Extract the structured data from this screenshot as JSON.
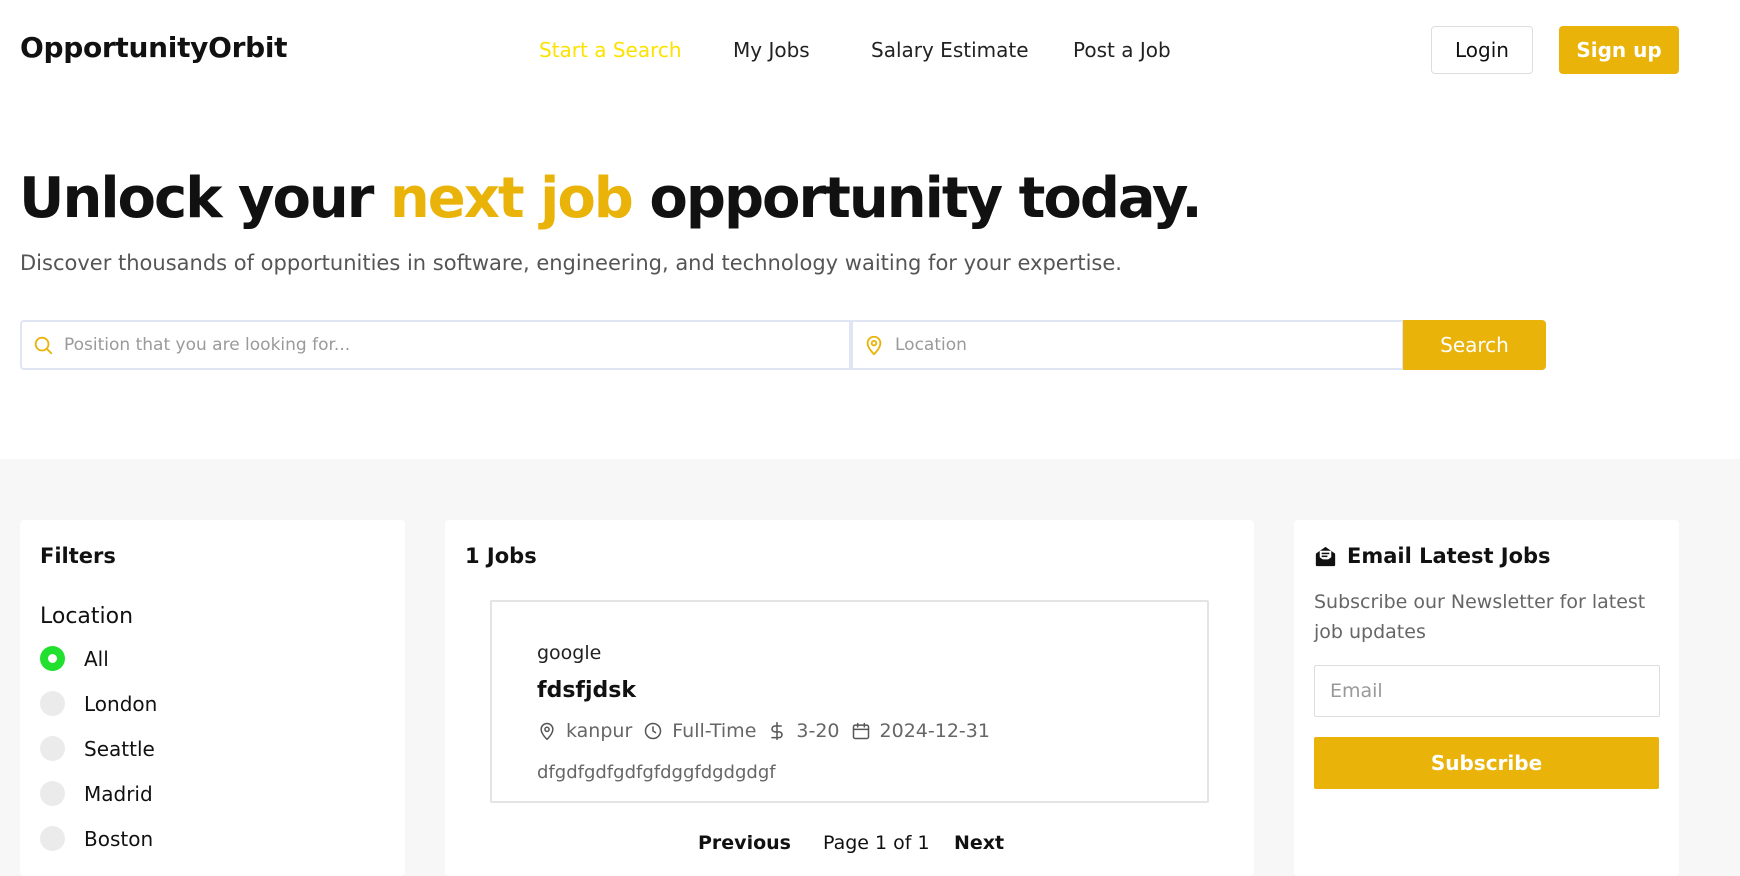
{
  "header": {
    "logo": "OpportunityOrbit",
    "nav": [
      {
        "label": "Start a Search",
        "active": true
      },
      {
        "label": "My Jobs",
        "active": false
      },
      {
        "label": "Salary Estimate",
        "active": false
      },
      {
        "label": "Post a Job",
        "active": false
      }
    ],
    "login_label": "Login",
    "signup_label": "Sign up"
  },
  "hero": {
    "title_before": "Unlock your ",
    "title_accent": "next job",
    "title_after": " opportunity today.",
    "subtitle": "Discover thousands of opportunities in software, engineering, and technology waiting for your expertise."
  },
  "search": {
    "position_placeholder": "Position that you are looking for...",
    "location_placeholder": "Location",
    "button_label": "Search"
  },
  "filters": {
    "title": "Filters",
    "location_label": "Location",
    "options": [
      {
        "label": "All",
        "checked": true
      },
      {
        "label": "London",
        "checked": false
      },
      {
        "label": "Seattle",
        "checked": false
      },
      {
        "label": "Madrid",
        "checked": false
      },
      {
        "label": "Boston",
        "checked": false
      }
    ]
  },
  "jobs": {
    "count_label": "1 Jobs",
    "items": [
      {
        "company": "google",
        "title": "fdsfjdsk",
        "location": "kanpur",
        "type": "Full-Time",
        "salary": "3-20",
        "date": "2024-12-31",
        "description": "dfgdfgdfgdfgfdggfdgdgdgf"
      }
    ],
    "pagination": {
      "previous_label": "Previous",
      "page_label": "Page 1 of 1",
      "next_label": "Next"
    }
  },
  "newsletter": {
    "title": "Email Latest Jobs",
    "description": "Subscribe our Newsletter for latest job updates",
    "email_placeholder": "Email",
    "button_label": "Subscribe"
  },
  "colors": {
    "accent": "#e9b30a",
    "nav_active": "#fde200",
    "radio_checked": "#22e02e",
    "section_bg": "#f7f7f7"
  }
}
